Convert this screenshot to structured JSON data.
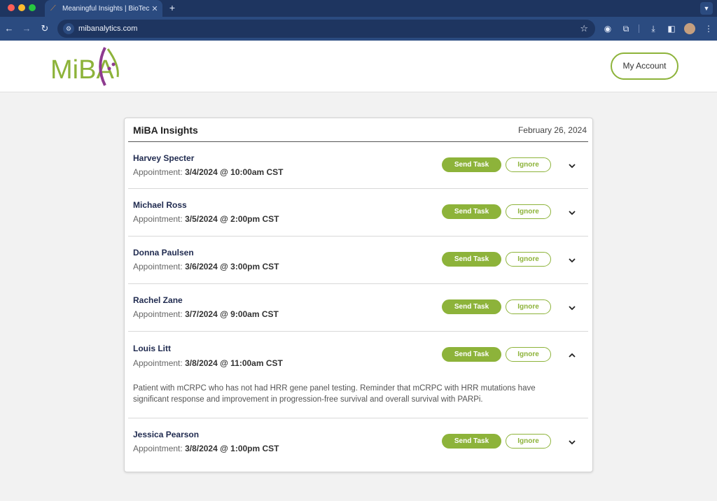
{
  "browser": {
    "tab_title": "Meaningful Insights | BioTech",
    "url": "mibanalytics.com"
  },
  "header": {
    "logo_text": "MiBA",
    "account_label": "My Account"
  },
  "colors": {
    "accent_green": "#8db33a",
    "logo_purple": "#8e3b8f",
    "name_navy": "#1f2a4f"
  },
  "insights": {
    "title": "MiBA Insights",
    "date": "February 26, 2024",
    "send_label": "Send Task",
    "ignore_label": "Ignore",
    "appointment_label": "Appointment:",
    "patients": [
      {
        "name": "Harvey Specter",
        "appointment": "3/4/2024 @ 10:00am CST",
        "expanded": false
      },
      {
        "name": "Michael Ross",
        "appointment": "3/5/2024 @ 2:00pm CST",
        "expanded": false
      },
      {
        "name": "Donna Paulsen",
        "appointment": "3/6/2024 @ 3:00pm CST",
        "expanded": false
      },
      {
        "name": "Rachel Zane",
        "appointment": "3/7/2024 @ 9:00am CST",
        "expanded": false
      },
      {
        "name": "Louis Litt",
        "appointment": "3/8/2024 @ 11:00am CST",
        "expanded": true,
        "note": "Patient with mCRPC who has not had HRR gene panel testing. Reminder that mCRPC with HRR mutations have significant response and improvement in progression-free survival and overall survival with PARPi."
      },
      {
        "name": "Jessica Pearson",
        "appointment": "3/8/2024 @ 1:00pm CST",
        "expanded": false
      }
    ]
  }
}
